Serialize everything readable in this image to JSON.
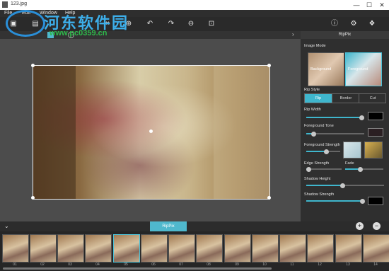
{
  "window": {
    "title": "123.jpg",
    "minimize": "—",
    "maximize": "☐",
    "close": "✕"
  },
  "menu": [
    "File",
    "Edit",
    "Window",
    "Help"
  ],
  "watermark": {
    "line1": "河东软件园",
    "line2": "www.pc0359.cn"
  },
  "panel": {
    "title": "RipPix",
    "image_mode_label": "Image Mode",
    "modes": [
      "Background",
      "Foreground"
    ],
    "selected_mode": "Foreground",
    "rip_style_label": "Rip Style",
    "rip_styles": [
      "Rip",
      "Border",
      "Cut"
    ],
    "selected_style": "Rip",
    "rip_width_label": "Rip Width",
    "rip_width": 0.95,
    "rip_width_color": "#000000",
    "foreground_tone_label": "Foreground Tone",
    "foreground_tone": 0.12,
    "foreground_tone_color": "#2a1f22",
    "foreground_strength_label": "Foreground Strength",
    "foreground_strength": 0.5,
    "edge_strength_label": "Edge Strength",
    "edge_strength": 0.05,
    "fade_label": "Fade",
    "fade": 0.55,
    "shadow_height_label": "Shadow Height",
    "shadow_height": 0.5,
    "shadow_strength_label": "Shadow Strength",
    "shadow_strength": 0.95,
    "shadow_color": "#000000"
  },
  "strip": {
    "tab_label": "RipPix",
    "add": "+",
    "remove": "−",
    "thumbnails": [
      "01",
      "02",
      "03",
      "04",
      "05",
      "06",
      "07",
      "08",
      "09",
      "10",
      "11",
      "12",
      "13",
      "14"
    ],
    "selected": "05"
  },
  "colors": {
    "accent": "#3fb6cd"
  }
}
